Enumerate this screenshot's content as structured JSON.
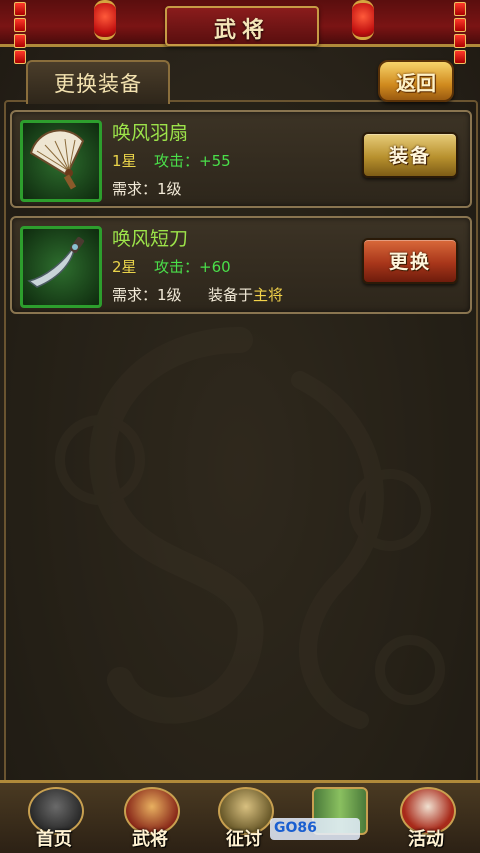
{
  "header": {
    "title": "武将"
  },
  "tab": {
    "label": "更换装备"
  },
  "back_button": {
    "label": "返回"
  },
  "items": [
    {
      "name": "唤风羽扇",
      "star": "1星",
      "attack": "攻击：+55",
      "requirement": "需求：1级",
      "equipped_prefix": "",
      "equipped_owner": "",
      "button_label": "装备",
      "icon": "feather-fan-icon"
    },
    {
      "name": "唤风短刀",
      "star": "2星",
      "attack": "攻击：+60",
      "requirement": "需求：1级",
      "equipped_prefix": "装备于",
      "equipped_owner": "主将",
      "button_label": "更换",
      "icon": "short-blade-icon"
    }
  ],
  "bottom_nav": [
    {
      "label": "首页",
      "icon": "home-pot-icon"
    },
    {
      "label": "武将",
      "icon": "general-helmet-icon"
    },
    {
      "label": "征讨",
      "icon": "campaign-shield-icon"
    },
    {
      "label": "",
      "icon": "bamboo-scroll-icon"
    },
    {
      "label": "活动",
      "icon": "drum-icon"
    }
  ],
  "watermark": {
    "text": "GO86"
  },
  "colors": {
    "item_name": "#9ce34a",
    "attack": "#4adf4a",
    "star": "#e9d34a",
    "owner": "#f3d34a",
    "equip_button": "#b8912e",
    "replace_button": "#a8361a"
  }
}
